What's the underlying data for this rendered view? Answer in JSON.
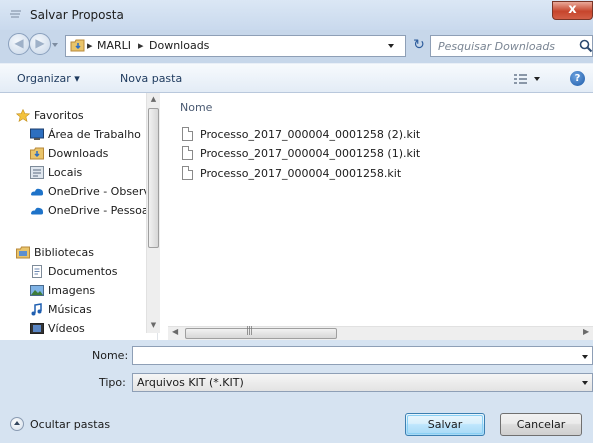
{
  "window": {
    "title": "Salvar Proposta",
    "close_label": "x"
  },
  "nav": {
    "back_glyph": "◀",
    "forward_glyph": "▶",
    "breadcrumb": [
      "MARLI",
      "Downloads"
    ],
    "separator": "▸",
    "refresh_glyph": "↻"
  },
  "search": {
    "placeholder": "Pesquisar Downloads"
  },
  "toolbar": {
    "organize_label": "Organizar ▾",
    "new_folder_label": "Nova pasta",
    "help_label": "?"
  },
  "sidebar": {
    "items": [
      {
        "label": "Favoritos",
        "icon": "star-icon"
      },
      {
        "label": "Área de Trabalho",
        "icon": "desktop-icon"
      },
      {
        "label": "Downloads",
        "icon": "downloads-folder-icon"
      },
      {
        "label": "Locais",
        "icon": "recent-places-icon"
      },
      {
        "label": "OneDrive - Observatório",
        "icon": "onedrive-icon"
      },
      {
        "label": "OneDrive - Pessoal",
        "icon": "onedrive-icon"
      },
      {
        "label": "Bibliotecas",
        "icon": "libraries-icon"
      },
      {
        "label": "Documentos",
        "icon": "documents-icon"
      },
      {
        "label": "Imagens",
        "icon": "pictures-icon"
      },
      {
        "label": "Músicas",
        "icon": "music-icon"
      },
      {
        "label": "Vídeos",
        "icon": "videos-icon"
      }
    ]
  },
  "files": {
    "column_name": "Nome",
    "items": [
      "Processo_2017_000004_0001258 (2).kit",
      "Processo_2017_000004_0001258 (1).kit",
      "Processo_2017_000004_0001258.kit"
    ]
  },
  "form": {
    "name_label": "Nome:",
    "name_value": "",
    "type_label": "Tipo:",
    "type_value": "Arquivos KIT (*.KIT)"
  },
  "footer": {
    "hide_folders_label": "Ocultar pastas",
    "save_label": "Salvar",
    "cancel_label": "Cancelar"
  },
  "colors": {
    "frame": "#c7d7ea",
    "toolbar": "#e3ecf6",
    "default_button": "#bee6fd"
  }
}
